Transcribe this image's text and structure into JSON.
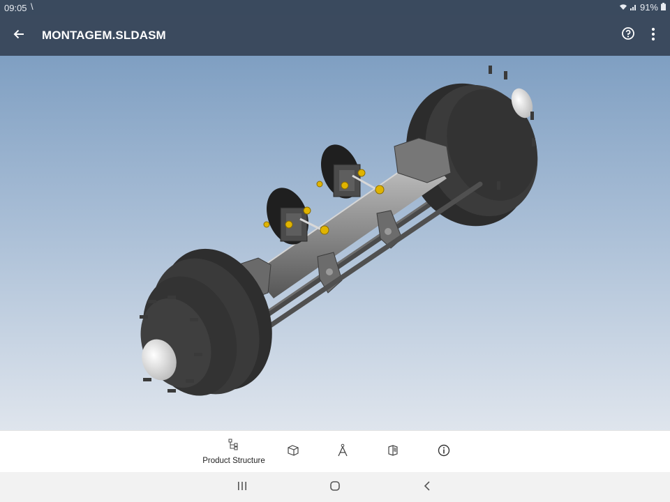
{
  "status_bar": {
    "time": "09:05",
    "notification_glyph": "\\",
    "battery": "91%",
    "icons": [
      "wifi-icon",
      "signal-icon",
      "battery-icon"
    ]
  },
  "app_bar": {
    "title": "MONTAGEM.SLDASM",
    "icons": [
      "back-arrow-icon",
      "help-icon",
      "more-vert-icon"
    ]
  },
  "viewport": {
    "model": "axle-assembly"
  },
  "toolbar": {
    "items": [
      {
        "label": "Product Structure",
        "icon": "product-structure-icon"
      },
      {
        "label": "",
        "icon": "view-cube-icon"
      },
      {
        "label": "",
        "icon": "measure-compass-icon"
      },
      {
        "label": "",
        "icon": "section-view-icon"
      },
      {
        "label": "",
        "icon": "info-icon"
      }
    ]
  },
  "nav_bar": {
    "icons": [
      "recent-apps-icon",
      "home-icon",
      "back-icon"
    ]
  },
  "colors": {
    "app_bar": "#3b4a5e",
    "viewport_top": "#7f9fc2",
    "viewport_bottom": "#dfe5ed",
    "toolbar": "#ffffff",
    "nav_bar": "#f2f2f2"
  }
}
